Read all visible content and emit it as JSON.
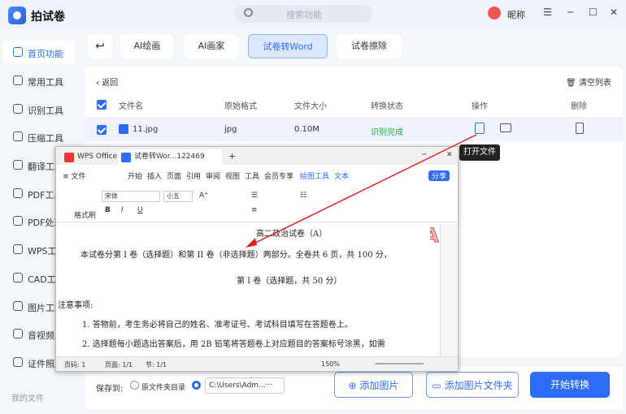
{
  "app": {
    "name": "拍试卷",
    "search_placeholder": "搜索功能",
    "user": "昵称"
  },
  "sidebar": {
    "items": [
      {
        "label": "首页功能",
        "icon": "home-icon"
      },
      {
        "label": "常用工具",
        "icon": "layers-icon"
      },
      {
        "label": "识别工具",
        "icon": "scan-icon"
      },
      {
        "label": "压缩工具",
        "icon": "compress-icon"
      },
      {
        "label": "翻译工具",
        "icon": "translate-icon"
      },
      {
        "label": "PDF工具",
        "icon": "pdf-icon"
      },
      {
        "label": "PDF处理",
        "icon": "pdf-process-icon"
      },
      {
        "label": "WPS工具",
        "icon": "wps-icon"
      },
      {
        "label": "CAD工具",
        "icon": "cad-icon"
      },
      {
        "label": "图片工具",
        "icon": "image-icon"
      },
      {
        "label": "音视频工具",
        "icon": "video-icon"
      },
      {
        "label": "证件照工具",
        "icon": "id-photo-icon"
      }
    ],
    "my_files": "我的文件"
  },
  "tabs": [
    "AI绘画",
    "AI画家",
    "试卷转Word",
    "试卷擦除"
  ],
  "list": {
    "back": "返回",
    "clear": "清空列表",
    "headers": [
      "文件名",
      "原始格式",
      "文件大小",
      "转换状态",
      "操作",
      "删除"
    ],
    "row": {
      "name": "11.jpg",
      "format": "jpg",
      "size": "0.10M",
      "status": "识别完成"
    },
    "tooltip": "打开文件"
  },
  "bottom": {
    "save_to": "保存到:",
    "option1": "原文件夹目录",
    "path": "C:\\Users\\Adm...",
    "more": "···",
    "add_image": "添加图片",
    "add_folder": "添加图片文件夹",
    "start": "开始转换"
  },
  "wps": {
    "tab1": "WPS Office",
    "tab2": "试卷转Wor...122469",
    "menu": [
      "≡ 文件",
      "开始",
      "插入",
      "页面",
      "引用",
      "审阅",
      "视图",
      "工具",
      "会员专享",
      "绘图工具",
      "文本",
      "分享"
    ],
    "font": "宋体",
    "size": "小五",
    "format_brush": "格式刷",
    "doc": {
      "title": "高二政治试卷（A）",
      "line1": "本试卷分第 I 卷（选择题）和第 II 卷（非选择题）两部分。全卷共 6 页，共 100 分，",
      "section": "第 I 卷（选择题，共 50 分）",
      "notice": "注意事项:",
      "item1": "1.  答物前，考生务必将自己的姓名、准考证号、考试科目填写在答题卷上。",
      "item2": "2.  选择题每小题选出答案后，用 2B 铅笔将答题卷上对应题目的答案标号涂黑，如需"
    },
    "status": {
      "page": "页码: 1",
      "pages": "页面: 1/1",
      "section": "节: 1/1",
      "zoom": "150%"
    }
  },
  "colors": {
    "accent": "#2d6cf6",
    "success": "#2ca84a",
    "annotation": "#e02020"
  }
}
